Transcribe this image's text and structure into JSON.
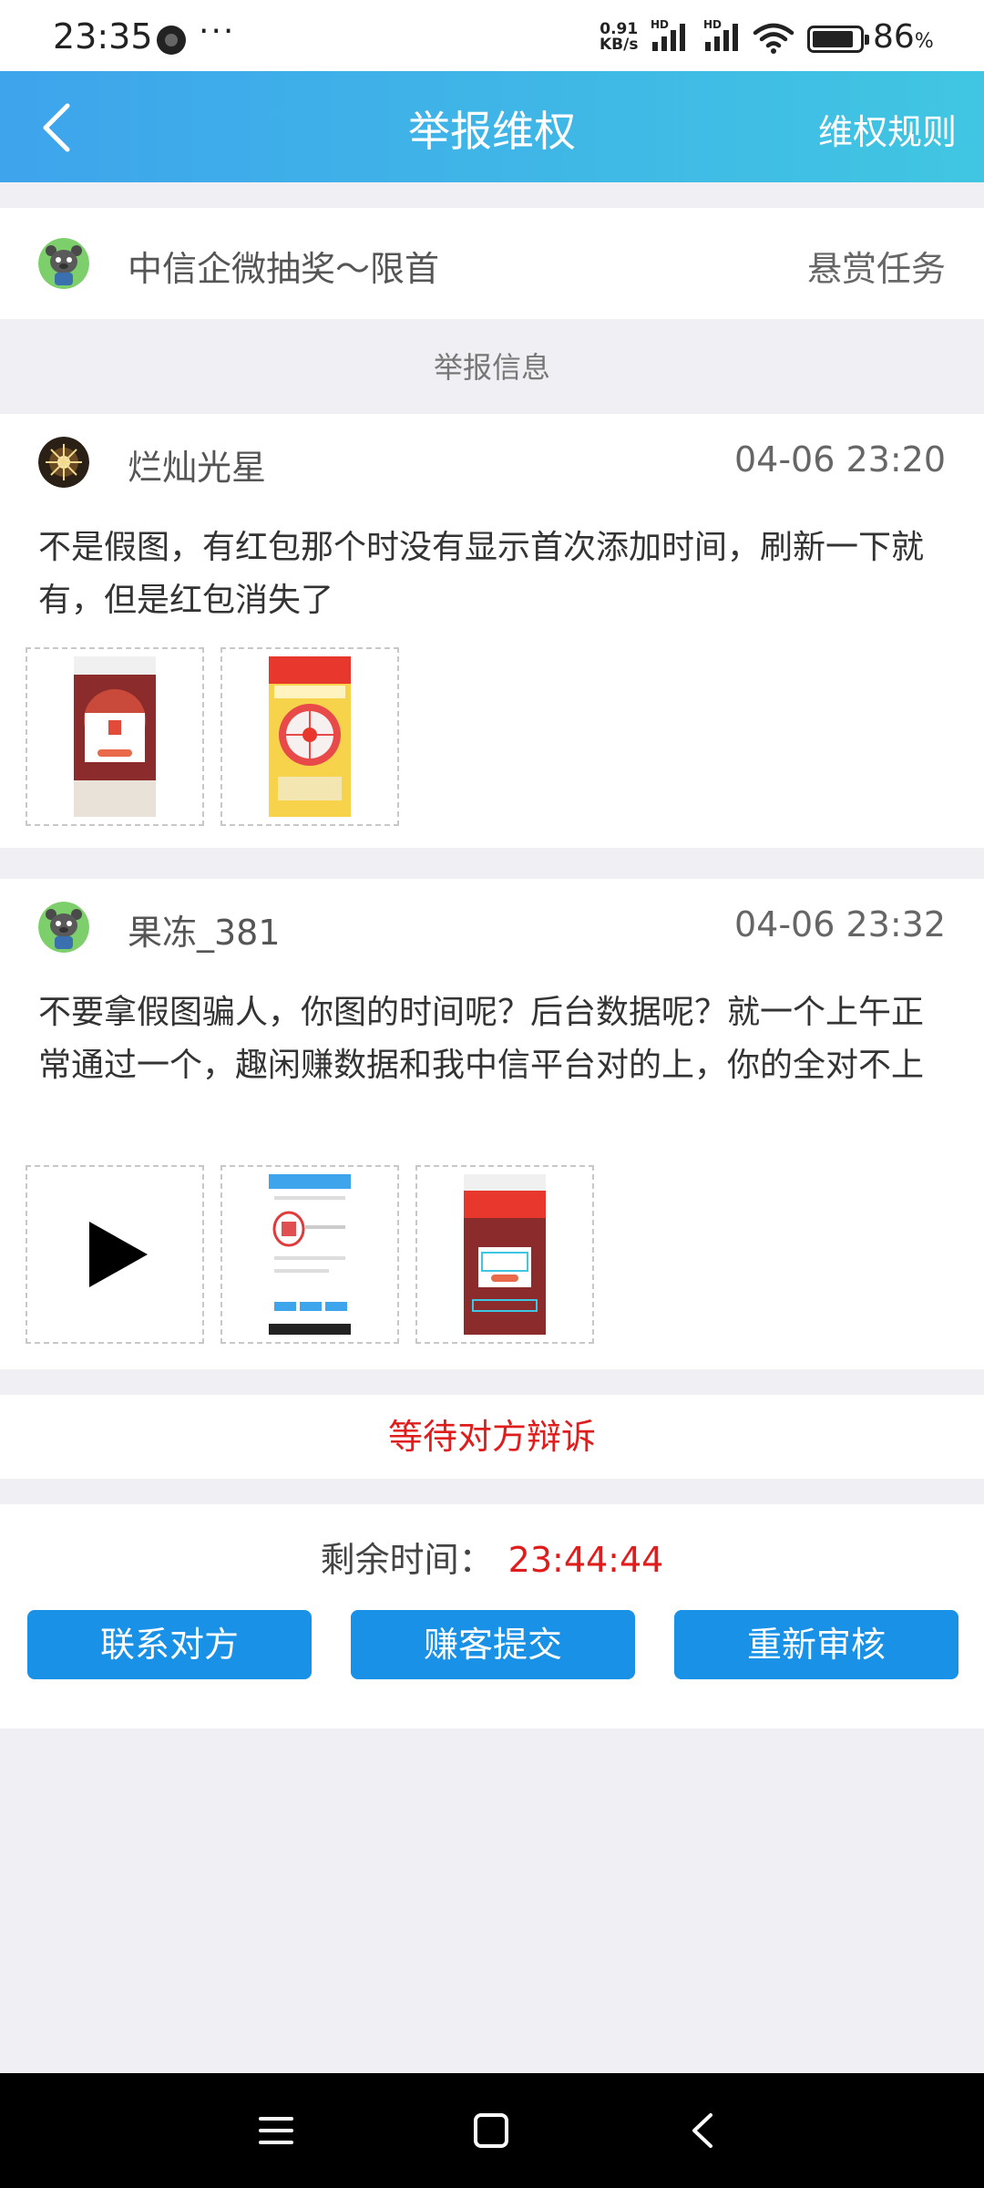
{
  "status_bar": {
    "time": "23:35",
    "more": "···",
    "net_speed_value": "0.91",
    "net_speed_unit": "KB/s",
    "signal_label": "HD",
    "battery": "86",
    "battery_unit": "%"
  },
  "header": {
    "title": "举报维权",
    "rule_link": "维权规则"
  },
  "task": {
    "title": "中信企微抽奖～限首",
    "type": "悬赏任务"
  },
  "section_label": "举报信息",
  "reports": [
    {
      "name": "烂灿光星",
      "time": "04-06 23:20",
      "text": "不是假图，有红包那个时没有显示首次添加时间，刷新一下就有，但是红包消失了"
    },
    {
      "name": "果冻_381",
      "time": "04-06 23:32",
      "text": "不要拿假图骗人，你图的时间呢？后台数据呢？就一个上午正常通过一个，趣闲赚数据和我中信平台对的上，你的全对不上"
    }
  ],
  "status_text": "等待对方辩诉",
  "remaining": {
    "label": "剩余时间：",
    "value": "23:44:44"
  },
  "buttons": {
    "contact": "联系对方",
    "submit": "赚客提交",
    "recheck": "重新审核"
  },
  "colors": {
    "header_start": "#3ea4ec",
    "header_end": "#40c6e2",
    "button": "#1891e6",
    "alert": "#e01d1d"
  }
}
